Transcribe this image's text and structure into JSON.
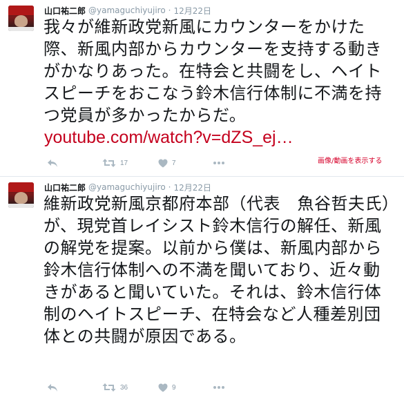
{
  "tweets": [
    {
      "name": "山口祐二郎",
      "handle": "@yamaguchiyujiro",
      "separator": "·",
      "date": "12月22日",
      "text": "我々が維新政党新風にカウンターをかけた際、新風内部からカウンターを支持する動きがかなりあった。在特会と共闘をし、ヘイトスピーチをおこなう鈴木信行体制に不満を持つ党員が多かったからだ。",
      "link": "youtube.com/watch?v=dZS_ej…",
      "media_label": "画像/動画を表示する",
      "retweets": "17",
      "likes": "7"
    },
    {
      "name": "山口祐二郎",
      "handle": "@yamaguchiyujiro",
      "separator": "·",
      "date": "12月22日",
      "text": "維新政党新風京都府本部（代表　魚谷哲夫氏）が、現党首レイシスト鈴木信行の解任、新風の解党を提案。以前から僕は、新風内部から鈴木信行体制への不満を聞いており、近々動きがあると聞いていた。それは、鈴木信行体制のヘイトスピーチ、在特会など人種差別団体との共闘が原因である。",
      "retweets": "36",
      "likes": "9"
    }
  ],
  "icons": {
    "reply": "reply-icon",
    "retweet": "retweet-icon",
    "like": "heart-icon",
    "more": "more-icon"
  },
  "colors": {
    "link": "#c4001d",
    "meta": "#8899a6",
    "text": "#14171a"
  }
}
